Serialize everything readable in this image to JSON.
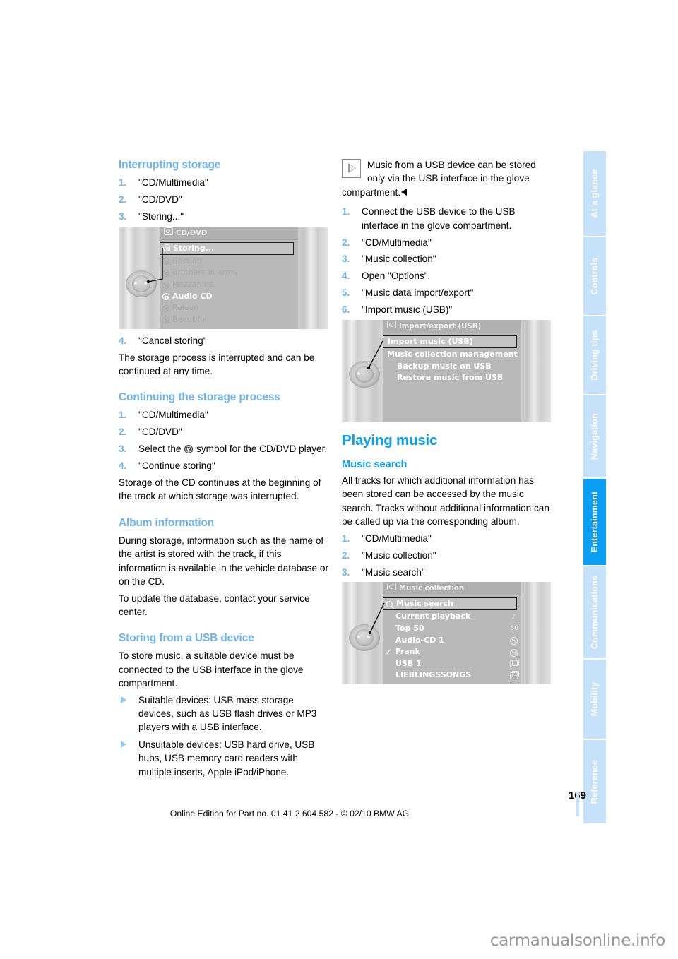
{
  "page": {
    "number": "169",
    "edition_line": "Online Edition for Part no. 01 41 2 604 582 - © 02/10 BMW AG",
    "watermark": "carmanualsonline.info",
    "accent_light": "#6db3f2",
    "accent_bright": "#0a9ff5",
    "tab_inactive": "#c6e2fb"
  },
  "sidebar": {
    "tabs": [
      {
        "label": "At a glance",
        "active": false
      },
      {
        "label": "Controls",
        "active": false
      },
      {
        "label": "Driving tips",
        "active": false
      },
      {
        "label": "Navigation",
        "active": false
      },
      {
        "label": "Entertainment",
        "active": true
      },
      {
        "label": "Communications",
        "active": false
      },
      {
        "label": "Mobility",
        "active": false
      },
      {
        "label": "Reference",
        "active": false
      }
    ]
  },
  "left_column": {
    "heading_interrupting": "Interrupting storage",
    "steps_interrupting": [
      {
        "num": "1.",
        "text": "\"CD/Multimedia\""
      },
      {
        "num": "2.",
        "text": "\"CD/DVD\""
      },
      {
        "num": "3.",
        "text": "\"Storing...\""
      }
    ],
    "step_cancel": {
      "num": "4.",
      "text": "\"Cancel storing\""
    },
    "para_interrupted": "The storage process is interrupted and can be continued at any time.",
    "heading_continuing": "Continuing the storage process",
    "steps_continuing": [
      {
        "num": "1.",
        "text": "\"CD/Multimedia\""
      },
      {
        "num": "2.",
        "text": "\"CD/DVD\""
      }
    ],
    "step_select_symbol_num": "3.",
    "step_select_symbol_pre": "Select the",
    "step_select_symbol_post": "symbol for the CD/DVD player.",
    "step_continue": {
      "num": "4.",
      "text": "\"Continue storing\""
    },
    "para_storage_continues": "Storage of the CD continues at the beginning of the track at which storage was interrupted.",
    "heading_album": "Album information",
    "para_album": "During storage, information such as the name of the artist is stored with the track, if this information is available in the vehicle database or on the CD.",
    "para_update": "To update the database, contact your service center.",
    "heading_usb": "Storing from a USB device",
    "para_usb": "To store music, a suitable device must be connected to the USB interface in the glove compartment.",
    "bullets": [
      "Suitable devices: USB mass storage devices, such as USB flash drives or MP3 players with a USB interface.",
      "Unsuitable devices: USB hard drive, USB hubs, USB memory card readers with multiple inserts, Apple iPod/iPhone."
    ]
  },
  "right_column": {
    "note_text": "Music from a USB device can be stored only via the USB interface in the glove compartment.",
    "steps_usb": [
      {
        "num": "1.",
        "text": "Connect the USB device to the USB interface in the glove compartment."
      },
      {
        "num": "2.",
        "text": "\"CD/Multimedia\""
      },
      {
        "num": "3.",
        "text": "\"Music collection\""
      },
      {
        "num": "4.",
        "text": "Open \"Options\"."
      },
      {
        "num": "5.",
        "text": "\"Music data import/export\""
      },
      {
        "num": "6.",
        "text": "\"Import music (USB)\""
      }
    ],
    "heading_playing": "Playing music",
    "heading_search": "Music search",
    "para_search": "All tracks for which additional information has been stored can be accessed by the music search. Tracks without additional information can be called up via the corresponding album.",
    "steps_search": [
      {
        "num": "1.",
        "text": "\"CD/Multimedia\""
      },
      {
        "num": "2.",
        "text": "\"Music collection\""
      },
      {
        "num": "3.",
        "text": "\"Music search\""
      }
    ]
  },
  "screens": {
    "cd_dvd": {
      "title": "CD/DVD",
      "rows": [
        {
          "label": "Storing...",
          "state": "selected",
          "icon": "disc-icon"
        },
        {
          "label": "Best off",
          "state": "dim",
          "icon": "disc-icon"
        },
        {
          "label": "Brothers in arms",
          "state": "dim",
          "icon": "disc-icon"
        },
        {
          "label": "Mezzanine",
          "state": "dim",
          "icon": "disc-icon"
        },
        {
          "label": "Audio CD",
          "state": "bright",
          "icon": "disc-icon"
        },
        {
          "label": "Reload",
          "state": "dim",
          "icon": "disc-icon"
        },
        {
          "label": "Beautiful",
          "state": "dim",
          "icon": "disc-icon"
        }
      ]
    },
    "import_export": {
      "title": "Import/export (USB)",
      "rows": [
        {
          "label": "Import music (USB)",
          "state": "selected",
          "icon": ""
        },
        {
          "label": "Music collection management",
          "state": "bright",
          "icon": ""
        },
        {
          "label": "Backup music on USB",
          "state": "bright",
          "icon": "",
          "indent": true
        },
        {
          "label": "Restore music from USB",
          "state": "bright",
          "icon": "",
          "indent": true
        }
      ]
    },
    "music_collection": {
      "title": "Music collection",
      "rows": [
        {
          "label": "Music search",
          "state": "selected",
          "icon": "search-icon",
          "right": ""
        },
        {
          "label": "Current playback",
          "state": "bright",
          "icon": "",
          "right": "note-icon"
        },
        {
          "label": "Top 50",
          "state": "bright",
          "icon": "",
          "right": "50"
        },
        {
          "label": "Audio-CD 1",
          "state": "bright",
          "icon": "",
          "right": "disc-icon"
        },
        {
          "label": "Frank",
          "state": "bright",
          "icon": "check-icon",
          "right": "disc-icon"
        },
        {
          "label": "USB 1",
          "state": "bright",
          "icon": "",
          "right": "folder-icon"
        },
        {
          "label": "LIEBLINGSSONGS",
          "state": "bright",
          "icon": "",
          "right": "folder-icon"
        }
      ]
    }
  }
}
